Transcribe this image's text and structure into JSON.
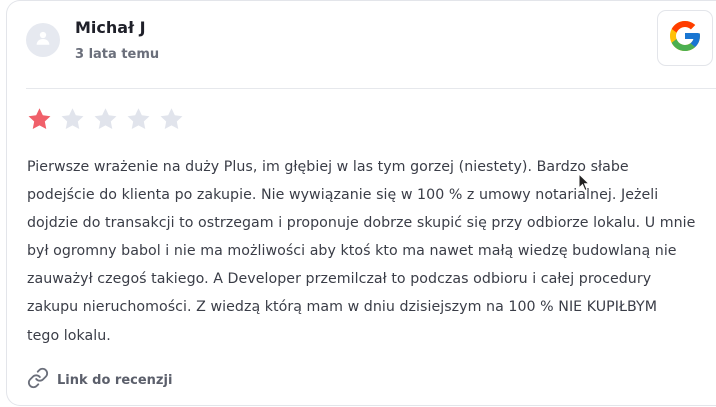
{
  "review": {
    "author_name": "Michał J",
    "date": "3 lata temu",
    "source_icon": "google-g-logo",
    "rating": 1,
    "max_rating": 5,
    "text_lines": [
      "Pierwsze wrażenie na duży Plus, im głębiej w las tym gorzej (niestety). Bardzo słabe",
      "podejście do klienta po zakupie. Nie wywiązanie się w 100 % z umowy notarialnej. Jeżeli",
      "dojdzie do transakcji to ostrzegam i proponuje dobrze skupić się przy odbiorze lokalu. U mnie",
      "był ogromny babol i nie ma możliwości aby ktoś kto ma nawet małą wiedzę budowlaną nie",
      "zauważył czegoś takiego. A Developer przemilczał to podczas odbioru i całej procedury",
      "zakupu nieruchomości. Z wiedzą którą mam w dniu dzisiejszym na 100 % NIE KUPIŁBYM",
      "tego lokalu."
    ],
    "link_label": "Link do recenzji",
    "link_icon": "link-icon"
  },
  "colors": {
    "star_filled": "#f0606a",
    "star_empty": "#e1e4ec",
    "text": "#3a3d47",
    "muted": "#6b6f7b",
    "border": "#e3e5ea"
  }
}
